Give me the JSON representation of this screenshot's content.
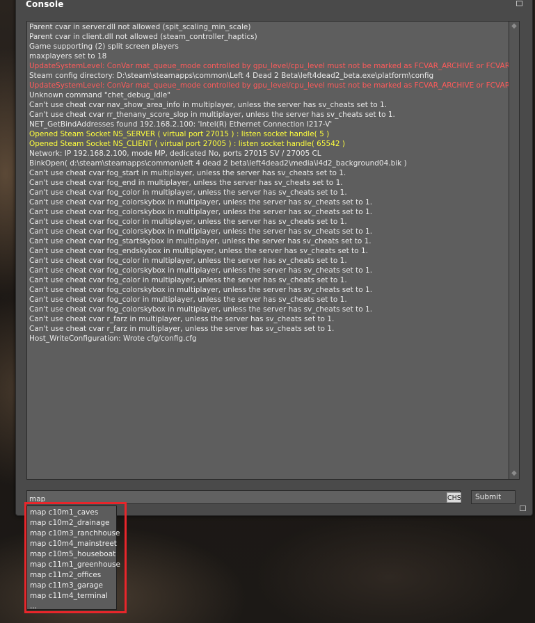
{
  "window": {
    "title": "Console"
  },
  "colors": {
    "normal": "#eaeaea",
    "error": "#ff5b5b",
    "highlight": "#ffff3d",
    "annotation": "#e8262b"
  },
  "log": [
    {
      "text": "Parent cvar in server.dll not allowed (spit_scaling_min_scale)",
      "type": "normal"
    },
    {
      "text": "Parent cvar in client.dll not allowed (steam_controller_haptics)",
      "type": "normal"
    },
    {
      "text": "Game supporting (2) split screen players",
      "type": "normal"
    },
    {
      "text": "maxplayers set to 18",
      "type": "normal"
    },
    {
      "text": "UpdateSystemLevel: ConVar mat_queue_mode controlled by gpu_level/cpu_level must not be marked as FCVAR_ARCHIVE or FCVAR_CHEAT!",
      "type": "error"
    },
    {
      "text": "Steam config directory: D:\\steam\\steamapps\\common\\Left 4 Dead 2 Beta\\left4dead2_beta.exe\\platform\\config",
      "type": "normal"
    },
    {
      "text": "UpdateSystemLevel: ConVar mat_queue_mode controlled by gpu_level/cpu_level must not be marked as FCVAR_ARCHIVE or FCVAR_CHEAT!",
      "type": "error"
    },
    {
      "text": "Unknown command \"chet_debug_idle\"",
      "type": "normal"
    },
    {
      "text": "Can't use cheat cvar nav_show_area_info in multiplayer, unless the server has sv_cheats set to 1.",
      "type": "normal"
    },
    {
      "text": "Can't use cheat cvar rr_thenany_score_slop in multiplayer, unless the server has sv_cheats set to 1.",
      "type": "normal"
    },
    {
      "text": "NET_GetBindAddresses found 192.168.2.100: 'Intel(R) Ethernet Connection I217-V'",
      "type": "normal"
    },
    {
      "text": "Opened Steam Socket NS_SERVER ( virtual port 27015 ) : listen socket handle( 5 )",
      "type": "highlight"
    },
    {
      "text": "Opened Steam Socket NS_CLIENT ( virtual port 27005 ) : listen socket handle( 65542 )",
      "type": "highlight"
    },
    {
      "text": "Network: IP 192.168.2.100, mode MP, dedicated No, ports 27015 SV / 27005 CL",
      "type": "normal"
    },
    {
      "text": "BinkOpen( d:\\steam\\steamapps\\common\\left 4 dead 2 beta\\left4dead2\\media\\l4d2_background04.bik )",
      "type": "normal"
    },
    {
      "text": "Can't use cheat cvar fog_start in multiplayer, unless the server has sv_cheats set to 1.",
      "type": "normal"
    },
    {
      "text": "Can't use cheat cvar fog_end in multiplayer, unless the server has sv_cheats set to 1.",
      "type": "normal"
    },
    {
      "text": "Can't use cheat cvar fog_color in multiplayer, unless the server has sv_cheats set to 1.",
      "type": "normal"
    },
    {
      "text": "Can't use cheat cvar fog_colorskybox in multiplayer, unless the server has sv_cheats set to 1.",
      "type": "normal"
    },
    {
      "text": "Can't use cheat cvar fog_colorskybox in multiplayer, unless the server has sv_cheats set to 1.",
      "type": "normal"
    },
    {
      "text": "Can't use cheat cvar fog_color in multiplayer, unless the server has sv_cheats set to 1.",
      "type": "normal"
    },
    {
      "text": "Can't use cheat cvar fog_colorskybox in multiplayer, unless the server has sv_cheats set to 1.",
      "type": "normal"
    },
    {
      "text": "Can't use cheat cvar fog_startskybox in multiplayer, unless the server has sv_cheats set to 1.",
      "type": "normal"
    },
    {
      "text": "Can't use cheat cvar fog_endskybox in multiplayer, unless the server has sv_cheats set to 1.",
      "type": "normal"
    },
    {
      "text": "Can't use cheat cvar fog_color in multiplayer, unless the server has sv_cheats set to 1.",
      "type": "normal"
    },
    {
      "text": "Can't use cheat cvar fog_colorskybox in multiplayer, unless the server has sv_cheats set to 1.",
      "type": "normal"
    },
    {
      "text": "Can't use cheat cvar fog_color in multiplayer, unless the server has sv_cheats set to 1.",
      "type": "normal"
    },
    {
      "text": "Can't use cheat cvar fog_colorskybox in multiplayer, unless the server has sv_cheats set to 1.",
      "type": "normal"
    },
    {
      "text": "Can't use cheat cvar fog_color in multiplayer, unless the server has sv_cheats set to 1.",
      "type": "normal"
    },
    {
      "text": "Can't use cheat cvar fog_colorskybox in multiplayer, unless the server has sv_cheats set to 1.",
      "type": "normal"
    },
    {
      "text": "Can't use cheat cvar r_farz in multiplayer, unless the server has sv_cheats set to 1.",
      "type": "normal"
    },
    {
      "text": "Can't use cheat cvar r_farz in multiplayer, unless the server has sv_cheats set to 1.",
      "type": "normal"
    },
    {
      "text": "Host_WriteConfiguration: Wrote cfg/config.cfg",
      "type": "normal"
    }
  ],
  "input": {
    "value": "map",
    "ime_label": "CHS"
  },
  "submit_label": "Submit",
  "suggestions": [
    "map c10m1_caves",
    "map c10m2_drainage",
    "map c10m3_ranchhouse",
    "map c10m4_mainstreet",
    "map c10m5_houseboat",
    "map c11m1_greenhouse",
    "map c11m2_offices",
    "map c11m3_garage",
    "map c11m4_terminal",
    "..."
  ]
}
